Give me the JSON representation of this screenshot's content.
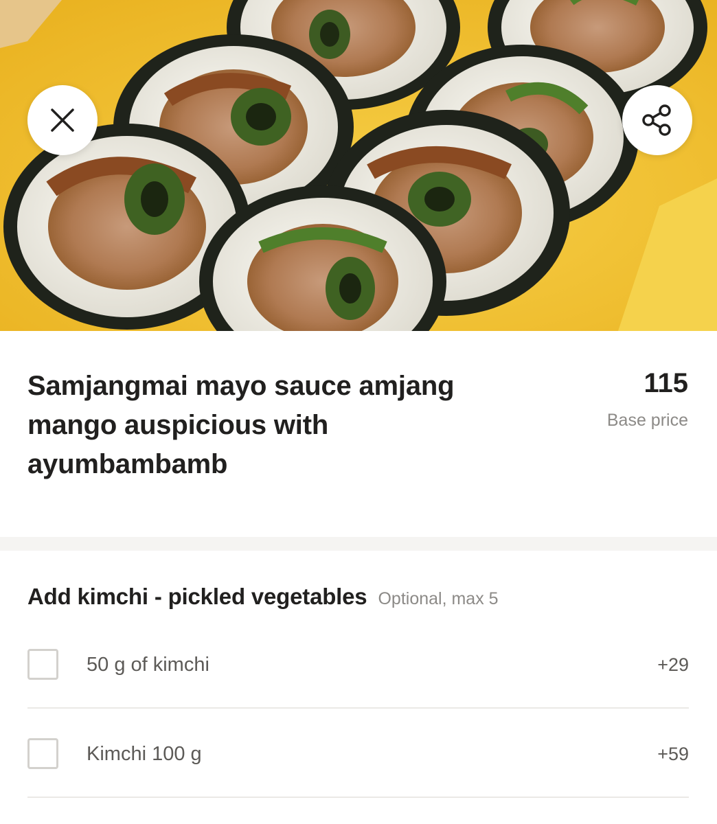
{
  "product": {
    "title": "Samjangmai mayo sauce amjang\nmango  auspicious with\nayumbambamb",
    "price": "115",
    "price_caption": "Base price"
  },
  "header_actions": {
    "close_icon": "close-icon",
    "share_icon": "share-icon"
  },
  "addons": {
    "title": "Add kimchi - pickled vegetables",
    "note": "Optional, max 5",
    "items": [
      {
        "label": "50 g of kimchi",
        "price": "+29",
        "checked": false
      },
      {
        "label": "Kimchi 100 g",
        "price": "+59",
        "checked": false
      }
    ]
  },
  "colors": {
    "text_primary": "#21201f",
    "text_secondary": "#8c8a87",
    "tray_yellow": "#f2c12e",
    "separator": "#f5f4f2"
  }
}
